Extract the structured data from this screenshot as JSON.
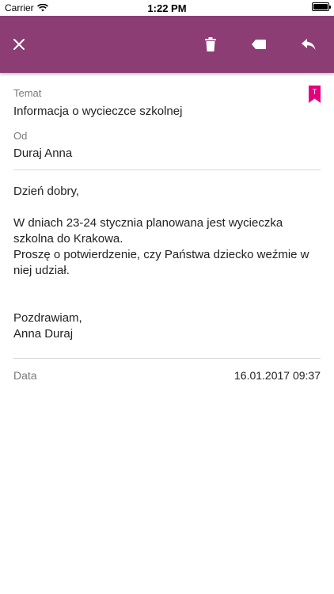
{
  "status_bar": {
    "carrier": "Carrier",
    "time": "1:22 PM",
    "battery_level": 1.0
  },
  "toolbar": {
    "close_icon": "close-icon",
    "delete_icon": "trash-icon",
    "label_icon": "label-icon",
    "reply_icon": "reply-icon",
    "background_color": "#8c3d73"
  },
  "message": {
    "subject_label": "Temat",
    "subject": "Informacja o wycieczce szkolnej",
    "from_label": "Od",
    "from": "Duraj Anna",
    "bookmark_letter": "T",
    "bookmark_color": "#e5007e",
    "body": {
      "greeting": "Dzień dobry,",
      "line1": "W dniach 23-24 stycznia planowana jest wycieczka szkolna do Krakowa.",
      "line2": "Proszę o potwierdzenie, czy Państwa dziecko weźmie w niej udział.",
      "closing": "Pozdrawiam,",
      "signature": "Anna Duraj"
    },
    "date_label": "Data",
    "date": "16.01.2017 09:37"
  }
}
